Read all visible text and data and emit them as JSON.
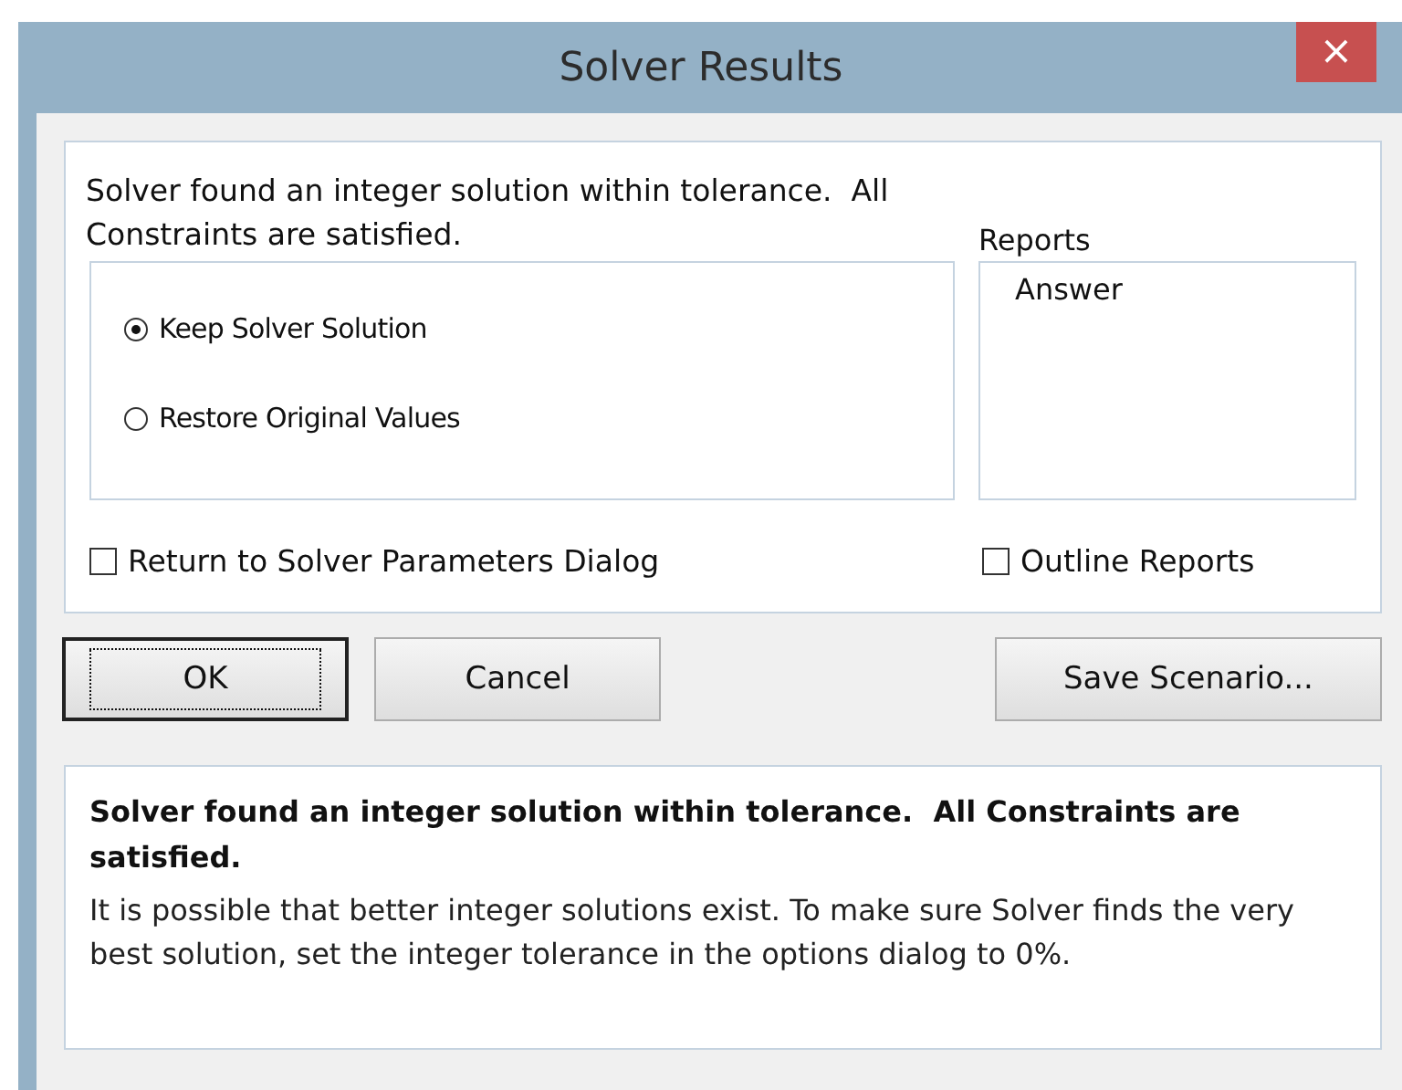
{
  "window": {
    "title": "Solver Results",
    "close": "×"
  },
  "message": "Solver found an integer solution within tolerance.  All Constraints are satisfied.",
  "options": [
    {
      "label": "Keep Solver Solution",
      "selected": true
    },
    {
      "label": "Restore Original Values",
      "selected": false
    }
  ],
  "reports": {
    "label": "Reports",
    "items": [
      {
        "label": "Answer",
        "selected": false
      }
    ]
  },
  "checkboxes": [
    {
      "label": "Return to Solver Parameters Dialog",
      "checked": false
    },
    {
      "label": "Outline Reports",
      "checked": false
    }
  ],
  "buttons": [
    {
      "label": "OK",
      "default": true
    },
    {
      "label": "Cancel",
      "default": false
    },
    {
      "label": "Save Scenario...",
      "default": false
    }
  ],
  "info": {
    "heading": "Solver found an integer solution within tolerance.  All Constraints are satisfied.",
    "body": "It is possible that better integer solutions exist. To make sure Solver finds the very best solution, set the integer tolerance in the options dialog to 0%."
  }
}
